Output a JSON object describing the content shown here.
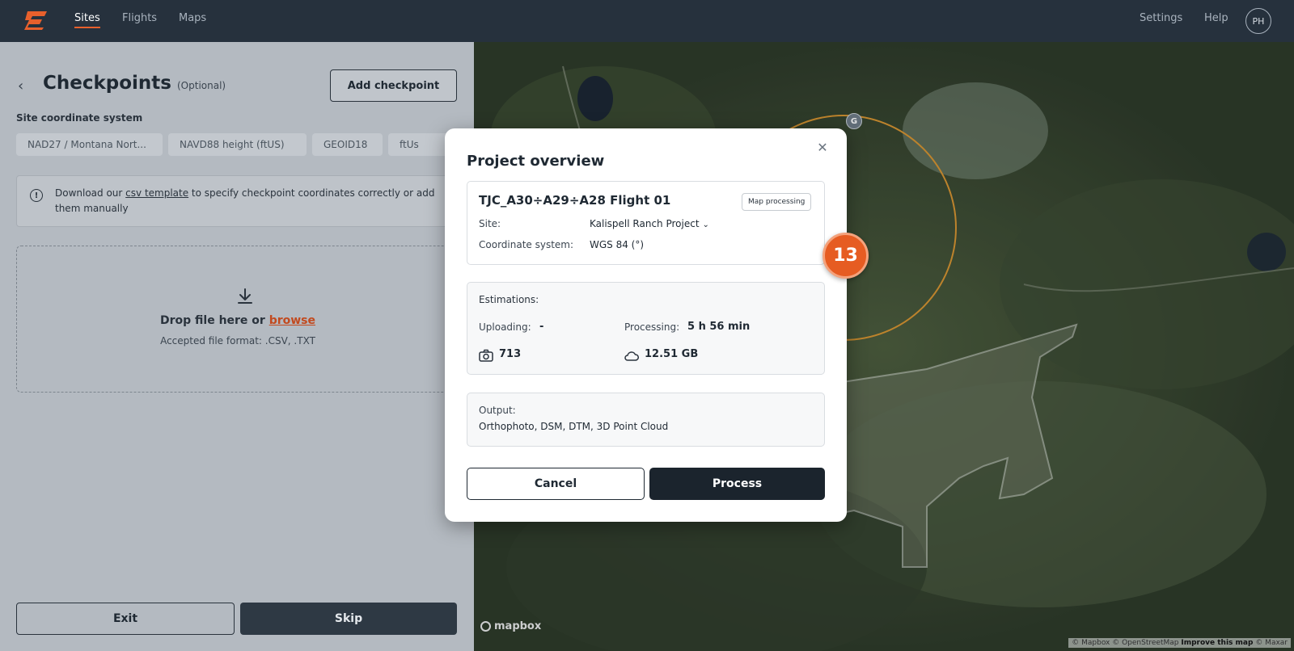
{
  "nav": {
    "items": [
      {
        "label": "Sites",
        "active": true
      },
      {
        "label": "Flights",
        "active": false
      },
      {
        "label": "Maps",
        "active": false
      }
    ],
    "settings_label": "Settings",
    "help_label": "Help",
    "avatar_initials": "PH"
  },
  "checkpoints": {
    "title": "Checkpoints",
    "optional_label": "(Optional)",
    "add_button_label": "Add checkpoint",
    "coordinate_system_label": "Site coordinate system",
    "coordinate_chips": [
      "NAD27 / Montana Nort...",
      "NAVD88 height (ftUS)",
      "GEOID18",
      "ftUs"
    ],
    "info": {
      "prefix": "Download our ",
      "link": "csv template",
      "suffix": " to specify checkpoint coordinates correctly or add them manually"
    },
    "dropzone": {
      "text": "Drop file here or ",
      "browse_link": "browse",
      "accepted": "Accepted file format: .CSV, .TXT"
    },
    "exit_label": "Exit",
    "skip_label": "Skip"
  },
  "modal": {
    "title": "Project overview",
    "flight": {
      "name": "TJC_A30÷A29÷A28 Flight 01",
      "badge": "Map processing",
      "site_label": "Site:",
      "site_value": "Kalispell Ranch Project",
      "coordinate_label": "Coordinate system:",
      "coordinate_value": "WGS 84 (°)"
    },
    "estimations": {
      "title": "Estimations:",
      "uploading_label": "Uploading:",
      "uploading_value": "-",
      "processing_label": "Processing:",
      "processing_value": "5 h 56 min",
      "photo_count": "713",
      "data_size": "12.51 GB"
    },
    "output": {
      "label": "Output:",
      "value": "Orthophoto, DSM, DTM, 3D Point Cloud"
    },
    "cancel_label": "Cancel",
    "process_label": "Process"
  },
  "map": {
    "marker_label": "G",
    "mapbox_label": "mapbox",
    "attribution": "© Mapbox © OpenStreetMap",
    "improve_link": "Improve this map",
    "maxar": "© Maxar"
  },
  "step_badge": "13",
  "colors": {
    "accent": "#e65c22",
    "nav_bg": "#26313d",
    "primary_button": "#1b242d"
  }
}
